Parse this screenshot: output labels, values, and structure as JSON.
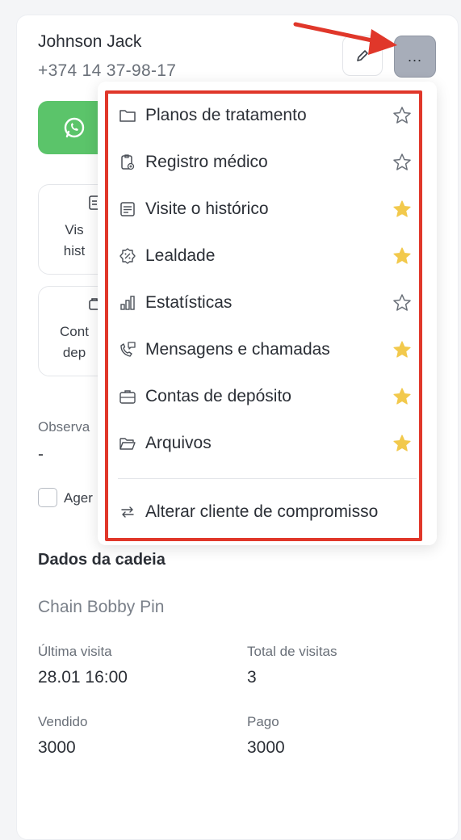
{
  "client": {
    "name": "Johnson Jack",
    "phone": "+374 14 37-98-17"
  },
  "actions": {
    "more_label": "..."
  },
  "tiles": [
    {
      "line1": "Vis",
      "line2": "hist"
    },
    {
      "line1": "Cont",
      "line2": "dep"
    }
  ],
  "notes": {
    "label": "Observa",
    "value": "-"
  },
  "checkbox": {
    "label": "Ager"
  },
  "chain": {
    "title": "Dados da cadeia",
    "name": "Chain Bobby Pin",
    "last_visit_label": "Última visita",
    "last_visit_value": "28.01 16:00",
    "total_visits_label": "Total de visitas",
    "total_visits_value": "3",
    "sold_label": "Vendido",
    "sold_value": "3000",
    "paid_label": "Pago",
    "paid_value": "3000"
  },
  "menu": {
    "items": [
      {
        "label": "Planos de tratamento",
        "icon": "folder-icon",
        "starred": false
      },
      {
        "label": "Registro médico",
        "icon": "medical-record-icon",
        "starred": false
      },
      {
        "label": "Visite o histórico",
        "icon": "history-list-icon",
        "starred": true
      },
      {
        "label": "Lealdade",
        "icon": "discount-badge-icon",
        "starred": true
      },
      {
        "label": "Estatísticas",
        "icon": "bar-chart-icon",
        "starred": false
      },
      {
        "label": "Mensagens e chamadas",
        "icon": "phone-chat-icon",
        "starred": true
      },
      {
        "label": "Contas de depósito",
        "icon": "briefcase-icon",
        "starred": true
      },
      {
        "label": "Arquivos",
        "icon": "folder-open-icon",
        "starred": true
      }
    ],
    "footer_item": {
      "label": "Alterar cliente de compromisso",
      "icon": "swap-arrows-icon"
    }
  },
  "colors": {
    "highlight": "#e0372a",
    "star_filled": "#f2c94c",
    "whatsapp": "#5bc46a"
  }
}
